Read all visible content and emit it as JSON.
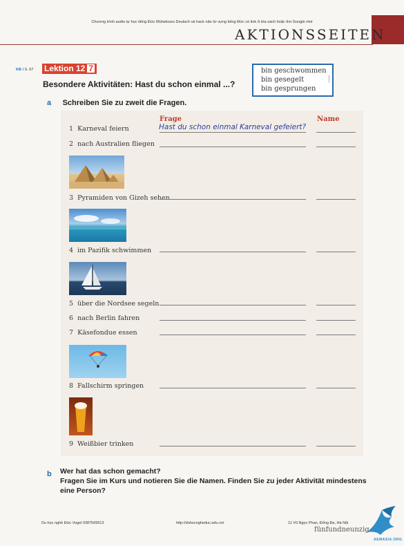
{
  "top_note": "Chương trình audio tự học tiếng Đức Müheloses Deutsch và hack não từ vựng tiếng Đức có link ở bìa sách hoặc tìm Google nhé",
  "header": {
    "title": "AKTIONSSEITEN"
  },
  "ref": {
    "kb": "KB",
    "page": "I S. 67"
  },
  "lesson": {
    "label": "Lektion 12",
    "number": "7"
  },
  "title": "Besondere Aktivitäten: Hast du schon einmal ...?",
  "info_box": {
    "lines": [
      "bin geschwommen",
      "bin gesegelt",
      "bin gesprungen"
    ],
    "side_label": "INFO"
  },
  "section_a": {
    "letter": "a",
    "instruction": "Schreiben Sie zu zweit die Fragen."
  },
  "table": {
    "col_frage": "Frage",
    "col_name": "Name",
    "example_answer": "Hast du schon einmal Karneval gefeiert?",
    "rows": [
      {
        "n": "1",
        "text": "Karneval feiern"
      },
      {
        "n": "2",
        "text": "nach Australien fliegen"
      },
      {
        "n": "3",
        "text": "Pyramiden von Gizeh sehen"
      },
      {
        "n": "4",
        "text": "im Pazifik schwimmen"
      },
      {
        "n": "5",
        "text": "über die Nordsee segeln"
      },
      {
        "n": "6",
        "text": "nach Berlin fahren"
      },
      {
        "n": "7",
        "text": "Käsefondue essen"
      },
      {
        "n": "8",
        "text": "Fallschirm springen"
      },
      {
        "n": "9",
        "text": "Weißbier trinken"
      }
    ]
  },
  "section_b": {
    "letter": "b",
    "question": "Wer hat das schon gemacht?",
    "instruction_1": "Fragen Sie im Kurs und notieren Sie die Namen. Finden Sie zu jeder Aktivität mindestens",
    "instruction_2": "eine Person?"
  },
  "footer": {
    "left": "Du học nghề Đức Vogel 0387569513",
    "center": "http://duhocngheduc.edu.vn/",
    "right": "11 Vũ Ngọc Phan, Đống Đa, Hà Nội",
    "page_word": "fünfundneunzig",
    "page_num": "95",
    "logo": "AEMASIA.ORG"
  }
}
